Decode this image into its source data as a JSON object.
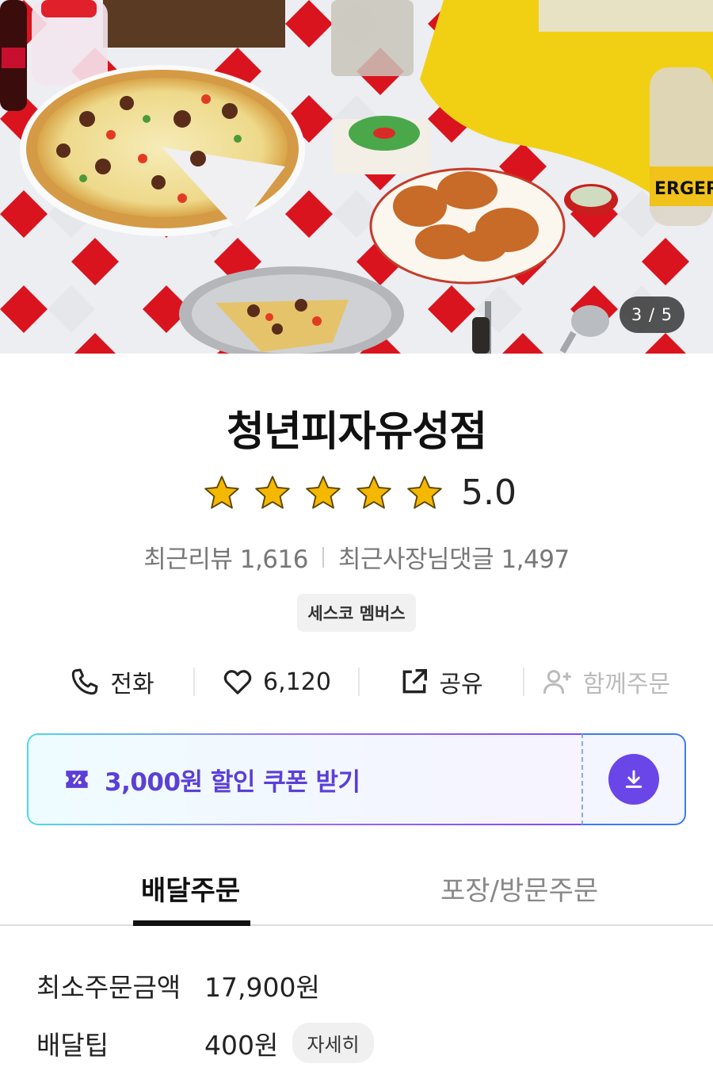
{
  "hero": {
    "pager": "3 / 5",
    "bottle_label": "ERGER"
  },
  "store": {
    "name": "청년피자유성점",
    "rating": 5.0,
    "rating_text": "5.0",
    "stars_filled": 5,
    "recent_reviews": "최근리뷰 1,616",
    "owner_replies": "최근사장님댓글 1,497",
    "badge": "세스코 멤버스"
  },
  "actions": {
    "call": "전화",
    "likes": "6,120",
    "share": "공유",
    "group_order": "함께주문"
  },
  "coupon": {
    "text": "3,000원 할인 쿠폰 받기"
  },
  "tabs": {
    "delivery": "배달주문",
    "pickup": "포장/방문주문"
  },
  "info": {
    "min_order_label": "최소주문금액",
    "min_order_value": "17,900원",
    "delivery_tip_label": "배달팁",
    "delivery_tip_value": "400원",
    "detail": "자세히"
  },
  "colors": {
    "accent": "#6a45e8",
    "coupon_text": "#5b3fd6",
    "star": "#f5b800"
  }
}
